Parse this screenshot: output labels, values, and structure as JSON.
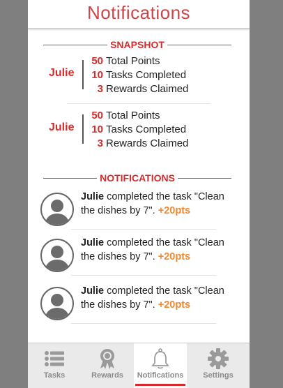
{
  "header": {
    "title": "Notifications"
  },
  "snapshot": {
    "heading": "SNAPSHOT",
    "entries": [
      {
        "name": "Julie",
        "points": "50",
        "points_label": "Total Points",
        "tasks": "10",
        "tasks_label": "Tasks Completed",
        "rewards": "3",
        "rewards_label": "Rewards Claimed"
      },
      {
        "name": "Julie",
        "points": "50",
        "points_label": "Total Points",
        "tasks": "10",
        "tasks_label": "Tasks Completed",
        "rewards": "3",
        "rewards_label": "Rewards Claimed"
      }
    ]
  },
  "notifications": {
    "heading": "NOTIFICATIONS",
    "items": [
      {
        "who": "Julie",
        "text": " completed the task \"Clean the dishes by 7\". ",
        "pts": "+20pts"
      },
      {
        "who": "Julie",
        "text": " completed the task \"Clean the dishes by 7\". ",
        "pts": "+20pts"
      },
      {
        "who": "Julie",
        "text": " completed the task \"Clean the dishes by 7\". ",
        "pts": "+20pts"
      }
    ]
  },
  "tabs": [
    {
      "label": "Tasks",
      "icon": "list-icon",
      "active": false
    },
    {
      "label": "Rewards",
      "icon": "award-ribbon-icon",
      "active": false
    },
    {
      "label": "Notifications",
      "icon": "bell-icon",
      "active": true
    },
    {
      "label": "Settings",
      "icon": "gear-icon",
      "active": false
    }
  ],
  "colors": {
    "accent": "#d62b2b",
    "points": "#f0882e",
    "header_title": "#d0454a"
  }
}
